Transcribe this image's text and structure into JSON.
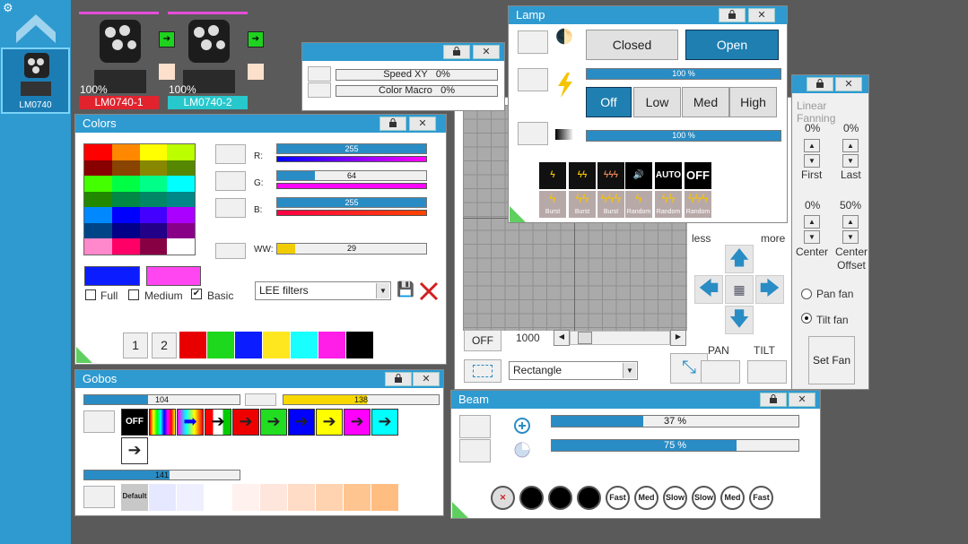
{
  "sidebar": {
    "selected_fixture": "LM0740"
  },
  "fixtures": [
    {
      "name": "LM0740-1",
      "intensity": "100%",
      "color": "#e2232e"
    },
    {
      "name": "LM0740-2",
      "intensity": "100%",
      "color": "#27c8cc"
    }
  ],
  "speedwin": {
    "speed_label": "Speed XY",
    "speed_value": "0%",
    "macro_label": "Color Macro",
    "macro_value": "0%"
  },
  "lamp": {
    "title": "Lamp",
    "closed": "Closed",
    "open": "Open",
    "bar1": "100 %",
    "off": "Off",
    "low": "Low",
    "med": "Med",
    "high": "High",
    "bar2": "100 %",
    "effects_top": [
      "AUTO",
      "OFF"
    ],
    "effects_bottom": [
      "Burst",
      "Burst",
      "Burst",
      "Random",
      "Random",
      "Random"
    ]
  },
  "colors": {
    "title": "Colors",
    "r_label": "R:",
    "r_value": "255",
    "g_label": "G:",
    "g_value": "64",
    "b_label": "B:",
    "b_value": "255",
    "ww_label": "WW:",
    "ww_value": "29",
    "full": "Full",
    "medium": "Medium",
    "basic": "Basic",
    "filter": "LEE filters",
    "page1": "1",
    "page2": "2",
    "bottom_swatches": [
      "#e80000",
      "#1ed81e",
      "#0b1cff",
      "#ffe720",
      "#19ffff",
      "#ff1ee8",
      "#000000"
    ]
  },
  "gobos": {
    "title": "Gobos",
    "bar1": "104",
    "bar2": "138",
    "bar3": "141",
    "off": "OFF",
    "default": "Default"
  },
  "linear": {
    "title": "Linear Fanning",
    "first_pct": "0%",
    "last_pct": "0%",
    "first": "First",
    "last": "Last",
    "center_pct": "0%",
    "offset_pct": "50%",
    "center": "Center",
    "offset": "Center Offset",
    "less": "less",
    "more": "more",
    "pan_fan": "Pan fan",
    "tilt_fan": "Tilt fan",
    "set_fan": "Set Fan"
  },
  "position": {
    "off": "OFF",
    "value": "1000",
    "shape": "Rectangle",
    "pan": "PAN",
    "tilt": "TILT"
  },
  "beam": {
    "title": "Beam",
    "zoom": "37 %",
    "focus": "75 %",
    "prism": [
      "Fast",
      "Med",
      "Slow",
      "Slow",
      "Med",
      "Fast"
    ]
  }
}
